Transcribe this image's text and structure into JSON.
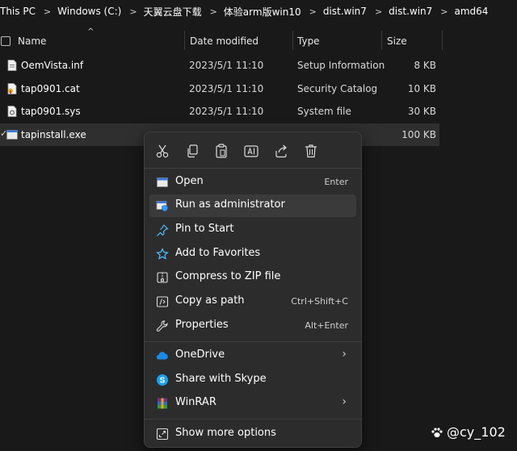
{
  "breadcrumb": [
    "This PC",
    "Windows (C:)",
    "天翼云盘下载",
    "体验arm版win10",
    "dist.win7",
    "dist.win7",
    "amd64"
  ],
  "columns": {
    "name": "Name",
    "date": "Date modified",
    "type": "Type",
    "size": "Size"
  },
  "files": [
    {
      "name": "OemVista.inf",
      "date": "2023/5/1 11:10",
      "type": "Setup Information",
      "size": "8 KB",
      "icon": "inf-file-icon"
    },
    {
      "name": "tap0901.cat",
      "date": "2023/5/1 11:10",
      "type": "Security Catalog",
      "size": "10 KB",
      "icon": "catalog-file-icon"
    },
    {
      "name": "tap0901.sys",
      "date": "2023/5/1 11:10",
      "type": "System file",
      "size": "30 KB",
      "icon": "sys-file-icon"
    },
    {
      "name": "tapinstall.exe",
      "date": "",
      "type": "",
      "size": "100 KB",
      "icon": "exe-file-icon"
    }
  ],
  "context_menu": {
    "toolbar": [
      "cut-icon",
      "copy-icon",
      "paste-icon",
      "rename-icon",
      "share-icon",
      "delete-icon"
    ],
    "items": [
      {
        "label": "Open",
        "shortcut": "Enter",
        "icon": "window-icon"
      },
      {
        "label": "Run as administrator",
        "shortcut": "",
        "icon": "shield-window-icon"
      },
      {
        "label": "Pin to Start",
        "shortcut": "",
        "icon": "pin-icon"
      },
      {
        "label": "Add to Favorites",
        "shortcut": "",
        "icon": "star-icon"
      },
      {
        "label": "Compress to ZIP file",
        "shortcut": "",
        "icon": "zip-icon"
      },
      {
        "label": "Copy as path",
        "shortcut": "Ctrl+Shift+C",
        "icon": "path-icon"
      },
      {
        "label": "Properties",
        "shortcut": "Alt+Enter",
        "icon": "wrench-icon"
      },
      {
        "label": "OneDrive",
        "shortcut": "",
        "icon": "cloud-icon",
        "submenu": true
      },
      {
        "label": "Share with Skype",
        "shortcut": "",
        "icon": "skype-icon"
      },
      {
        "label": "WinRAR",
        "shortcut": "",
        "icon": "winrar-icon",
        "submenu": true
      },
      {
        "label": "Show more options",
        "shortcut": "",
        "icon": "more-options-icon"
      }
    ]
  },
  "watermark": "@cy_102",
  "colors": {
    "background": "#191919",
    "menu": "#2c2c2c",
    "accent": "#4cc2ff"
  }
}
